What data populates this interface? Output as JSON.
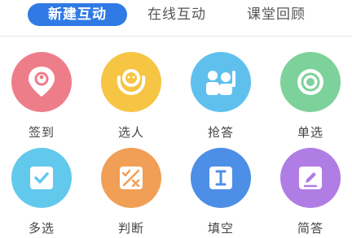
{
  "tabs": [
    {
      "label": "新建互动",
      "active": true
    },
    {
      "label": "在线互动",
      "active": false
    },
    {
      "label": "课堂回顾",
      "active": false
    }
  ],
  "tools": [
    {
      "label": "签到",
      "icon": "location-pin-icon",
      "color": "#ee7d8a"
    },
    {
      "label": "选人",
      "icon": "person-select-icon",
      "color": "#f6c544"
    },
    {
      "label": "抢答",
      "icon": "group-raise-hand-icon",
      "color": "#5fc0ee"
    },
    {
      "label": "单选",
      "icon": "radio-single-icon",
      "color": "#7dd19b"
    },
    {
      "label": "多选",
      "icon": "checkbox-icon",
      "color": "#62c9ec"
    },
    {
      "label": "判断",
      "icon": "true-false-icon",
      "color": "#f19f56"
    },
    {
      "label": "填空",
      "icon": "text-cursor-icon",
      "color": "#4d8ee6"
    },
    {
      "label": "简答",
      "icon": "edit-pencil-icon",
      "color": "#b07de4"
    }
  ]
}
